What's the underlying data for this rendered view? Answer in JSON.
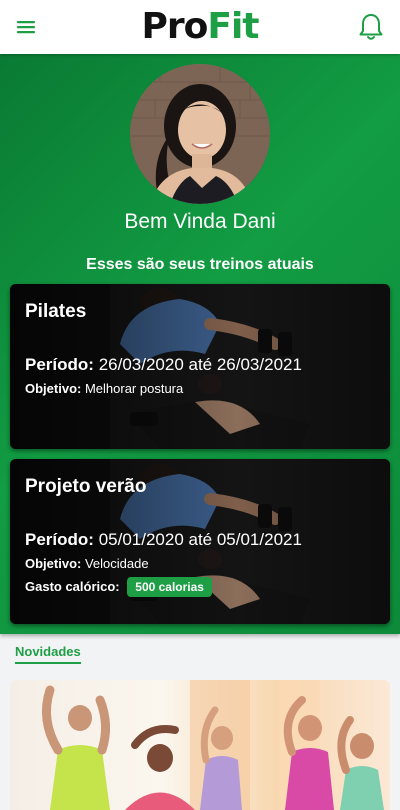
{
  "header": {
    "logo_pro": "Pro",
    "logo_fit": "Fit",
    "menu_icon": "hamburger-menu-icon",
    "bell_icon": "bell-icon"
  },
  "colors": {
    "brand_green": "#1e9e45",
    "hero_green": "#0f9240",
    "logo_dark": "#111111"
  },
  "profile": {
    "greeting": "Bem Vinda Dani"
  },
  "workouts_section": {
    "title": "Esses são seus treinos atuais"
  },
  "workouts": [
    {
      "name": "Pilates",
      "period_label": "Período:",
      "period_value": "26/03/2020 até 26/03/2021",
      "objective_label": "Objetivo:",
      "objective_value": "Melhorar postura"
    },
    {
      "name": "Projeto verão",
      "period_label": "Período:",
      "period_value": "05/01/2020 até 05/01/2021",
      "objective_label": "Objetivo:",
      "objective_value": "Velocidade",
      "calories_label": "Gasto calórico:",
      "calories_value": "500 calorias"
    }
  ],
  "news": {
    "title": "Novidades"
  }
}
